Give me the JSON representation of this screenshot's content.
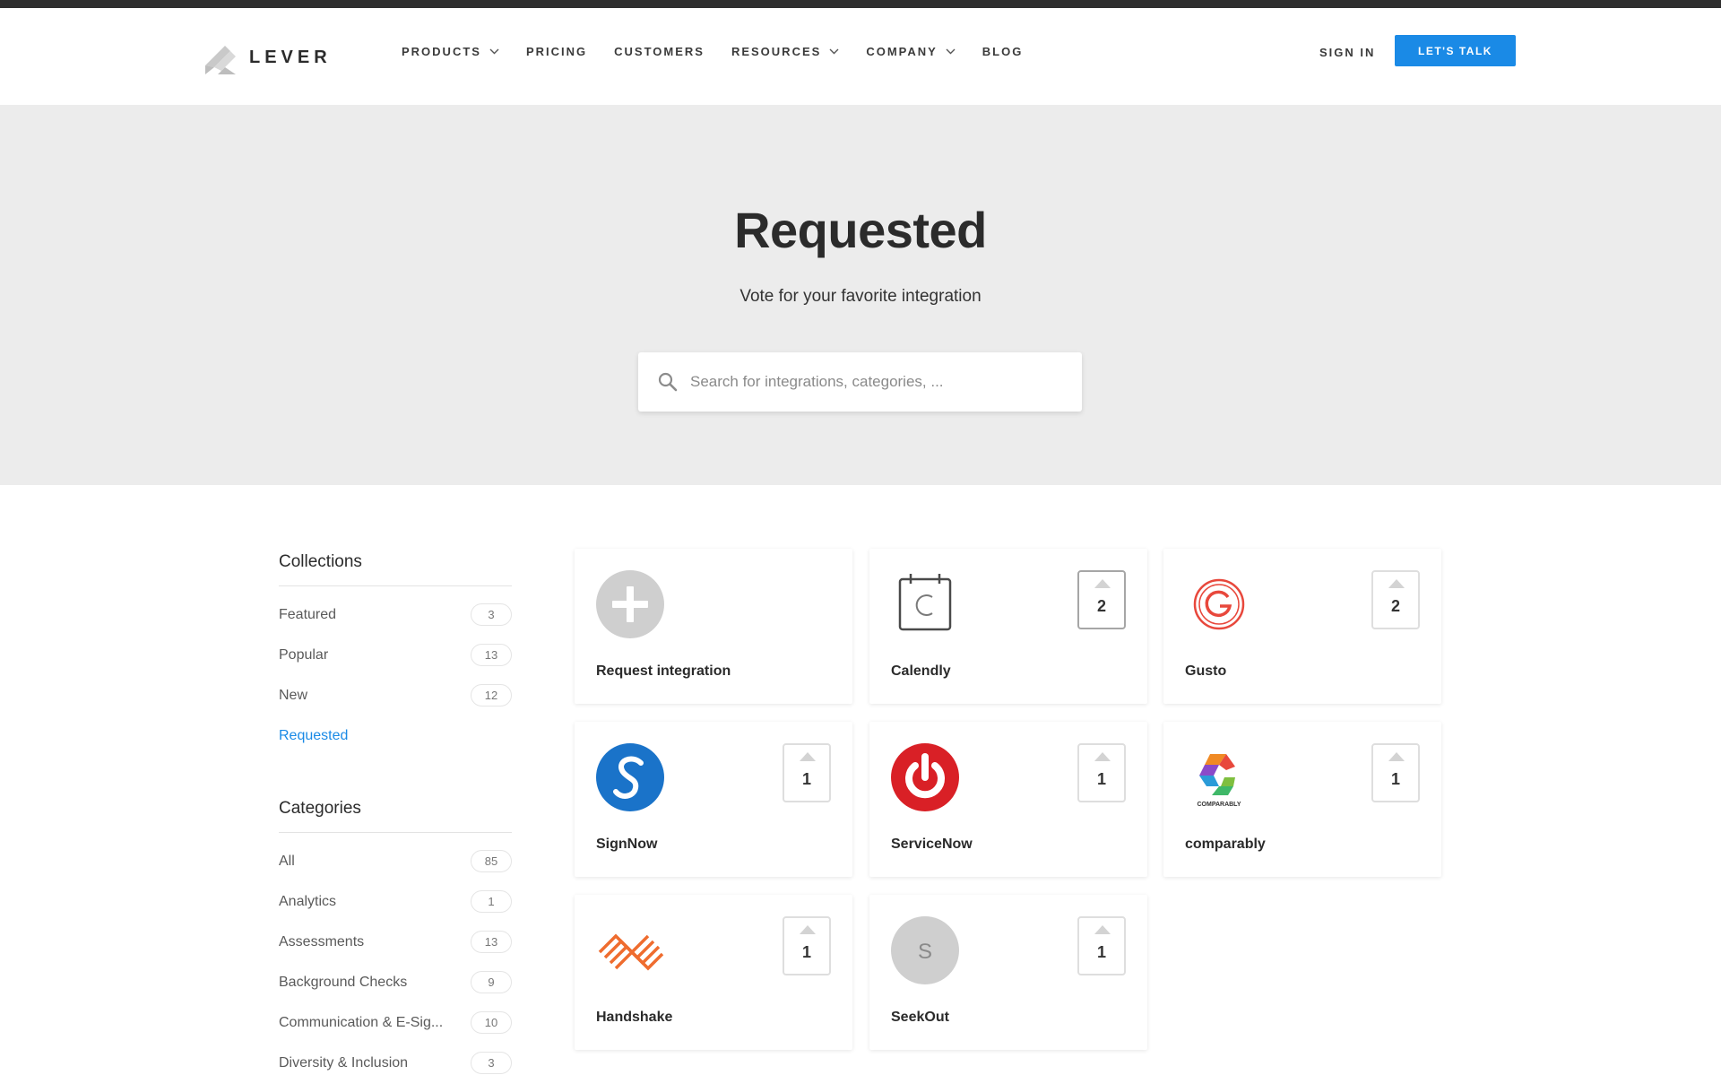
{
  "header": {
    "logo_text": "LEVER",
    "nav": [
      {
        "label": "PRODUCTS",
        "has_dropdown": true
      },
      {
        "label": "PRICING",
        "has_dropdown": false
      },
      {
        "label": "CUSTOMERS",
        "has_dropdown": false
      },
      {
        "label": "RESOURCES",
        "has_dropdown": true
      },
      {
        "label": "COMPANY",
        "has_dropdown": true
      },
      {
        "label": "BLOG",
        "has_dropdown": false
      }
    ],
    "sign_in": "SIGN IN",
    "cta": "LET'S TALK"
  },
  "hero": {
    "title": "Requested",
    "subtitle": "Vote for your favorite integration",
    "search_placeholder": "Search for integrations, categories, ..."
  },
  "sidebar": {
    "collections_title": "Collections",
    "collections": [
      {
        "label": "Featured",
        "count": "3"
      },
      {
        "label": "Popular",
        "count": "13"
      },
      {
        "label": "New",
        "count": "12"
      },
      {
        "label": "Requested",
        "count": "",
        "active": true
      }
    ],
    "categories_title": "Categories",
    "categories": [
      {
        "label": "All",
        "count": "85"
      },
      {
        "label": "Analytics",
        "count": "1"
      },
      {
        "label": "Assessments",
        "count": "13"
      },
      {
        "label": "Background Checks",
        "count": "9"
      },
      {
        "label": "Communication & E-Sig...",
        "count": "10"
      },
      {
        "label": "Diversity & Inclusion",
        "count": "3"
      }
    ]
  },
  "cards": [
    {
      "name": "Request integration",
      "icon": "plus-circle-icon",
      "votes": ""
    },
    {
      "name": "Calendly",
      "icon": "calendly-logo",
      "votes": "2"
    },
    {
      "name": "Gusto",
      "icon": "gusto-logo",
      "votes": "2"
    },
    {
      "name": "SignNow",
      "icon": "signnow-logo",
      "votes": "1"
    },
    {
      "name": "ServiceNow",
      "icon": "servicenow-logo",
      "votes": "1"
    },
    {
      "name": "comparably",
      "icon": "comparably-logo",
      "votes": "1",
      "logo_text": "COMPARABLY"
    },
    {
      "name": "Handshake",
      "icon": "handshake-logo",
      "votes": "1"
    },
    {
      "name": "SeekOut",
      "icon": "seekout-logo",
      "votes": "1",
      "logo_text": "S"
    }
  ],
  "colors": {
    "accent": "#1a8ae6",
    "hero_bg": "#ececec",
    "topbar": "#2f2f2f"
  }
}
